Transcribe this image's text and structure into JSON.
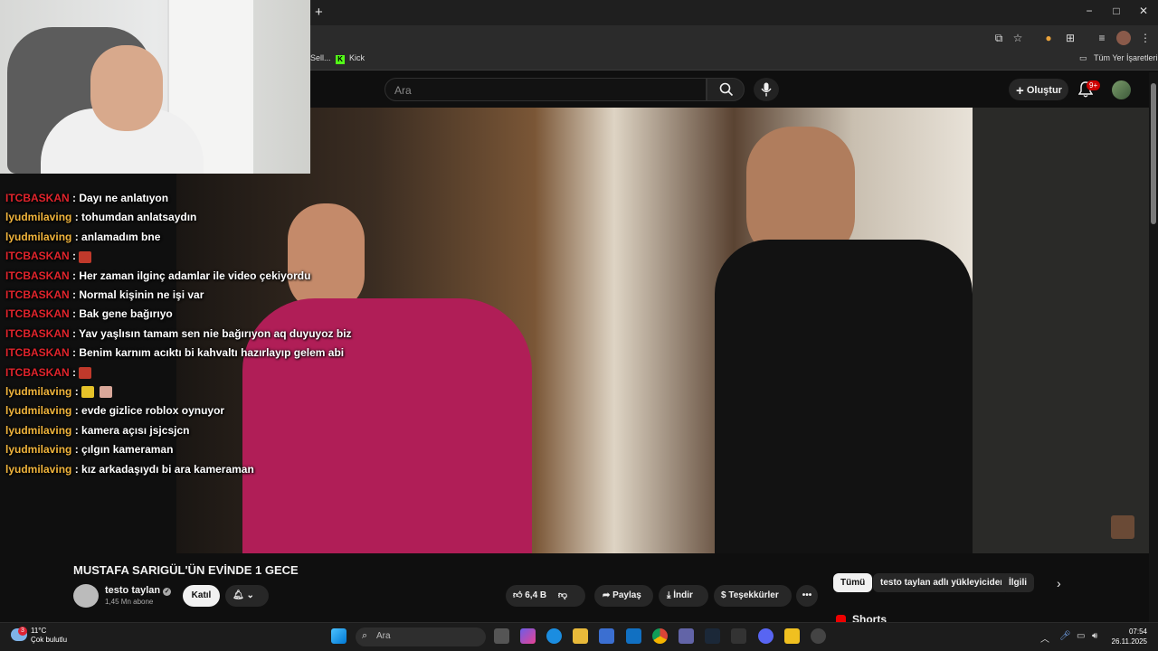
{
  "browser": {
    "new_tab": "+",
    "window_controls": [
      "−",
      "□",
      "✕"
    ],
    "bookmarks": [
      "Sell...",
      "Kick"
    ],
    "bookmarks_folder": "Tüm Yer İşaretleri"
  },
  "youtube": {
    "search_placeholder": "Ara",
    "create_label": "Oluştur",
    "notification_count": "9+",
    "video_title": "MUSTAFA SARIGÜL'ÜN EVİNDE 1 GECE",
    "channel_name": "testo taylan",
    "subscribers": "1,45 Mn abone",
    "join_label": "Katıl",
    "likes": "6,4 B",
    "share_label": "Paylaş",
    "download_label": "İndir",
    "thanks_label": "Teşekkürler",
    "chips": [
      "Tümü",
      "testo taylan adlı yükleyiciden",
      "İlgili"
    ],
    "shorts_label": "Shorts"
  },
  "chat": [
    {
      "user": "ITCBASKAN",
      "msg": "Dayı ne anlatıyon",
      "color": "#e0242c"
    },
    {
      "user": "lyudmilaving",
      "msg": "tohumdan anlatsaydın",
      "color": "#f0b43c"
    },
    {
      "user": "lyudmilaving",
      "msg": "anlamadım bne",
      "color": "#f0b43c"
    },
    {
      "user": "ITCBASKAN",
      "msg": "",
      "emotes": 1,
      "color": "#e0242c"
    },
    {
      "user": "ITCBASKAN",
      "msg": "Her zaman ilginç adamlar ile video çekiyordu",
      "color": "#e0242c"
    },
    {
      "user": "ITCBASKAN",
      "msg": "Normal kişinin ne işi var",
      "color": "#e0242c"
    },
    {
      "user": "ITCBASKAN",
      "msg": "Bak gene bağırıyo",
      "color": "#e0242c"
    },
    {
      "user": "ITCBASKAN",
      "msg": "Yav yaşlısın tamam sen nie bağırıyon aq duyuyoz biz",
      "color": "#e0242c"
    },
    {
      "user": "ITCBASKAN",
      "msg": "Benim karnım acıktı bi kahvaltı hazırlayıp gelem abi",
      "color": "#e0242c"
    },
    {
      "user": "ITCBASKAN",
      "msg": "",
      "emotes": 1,
      "color": "#e0242c"
    },
    {
      "user": "lyudmilaving",
      "msg": "",
      "emotes": 2,
      "color": "#f0b43c"
    },
    {
      "user": "lyudmilaving",
      "msg": "evde gizlice roblox oynuyor",
      "color": "#f0b43c"
    },
    {
      "user": "lyudmilaving",
      "msg": "kamera açısı jsjcsjcn",
      "color": "#f0b43c"
    },
    {
      "user": "lyudmilaving",
      "msg": "çılgın kameraman",
      "color": "#f0b43c"
    },
    {
      "user": "lyudmilaving",
      "msg": "kız arkadaşıydı bi ara kameraman",
      "color": "#f0b43c"
    }
  ],
  "taskbar": {
    "weather_badge": "3",
    "temperature": "11°C",
    "weather_text": "Çok bulutlu",
    "search_placeholder": "Ara",
    "time": "07:54",
    "date": "26.11.2025"
  }
}
